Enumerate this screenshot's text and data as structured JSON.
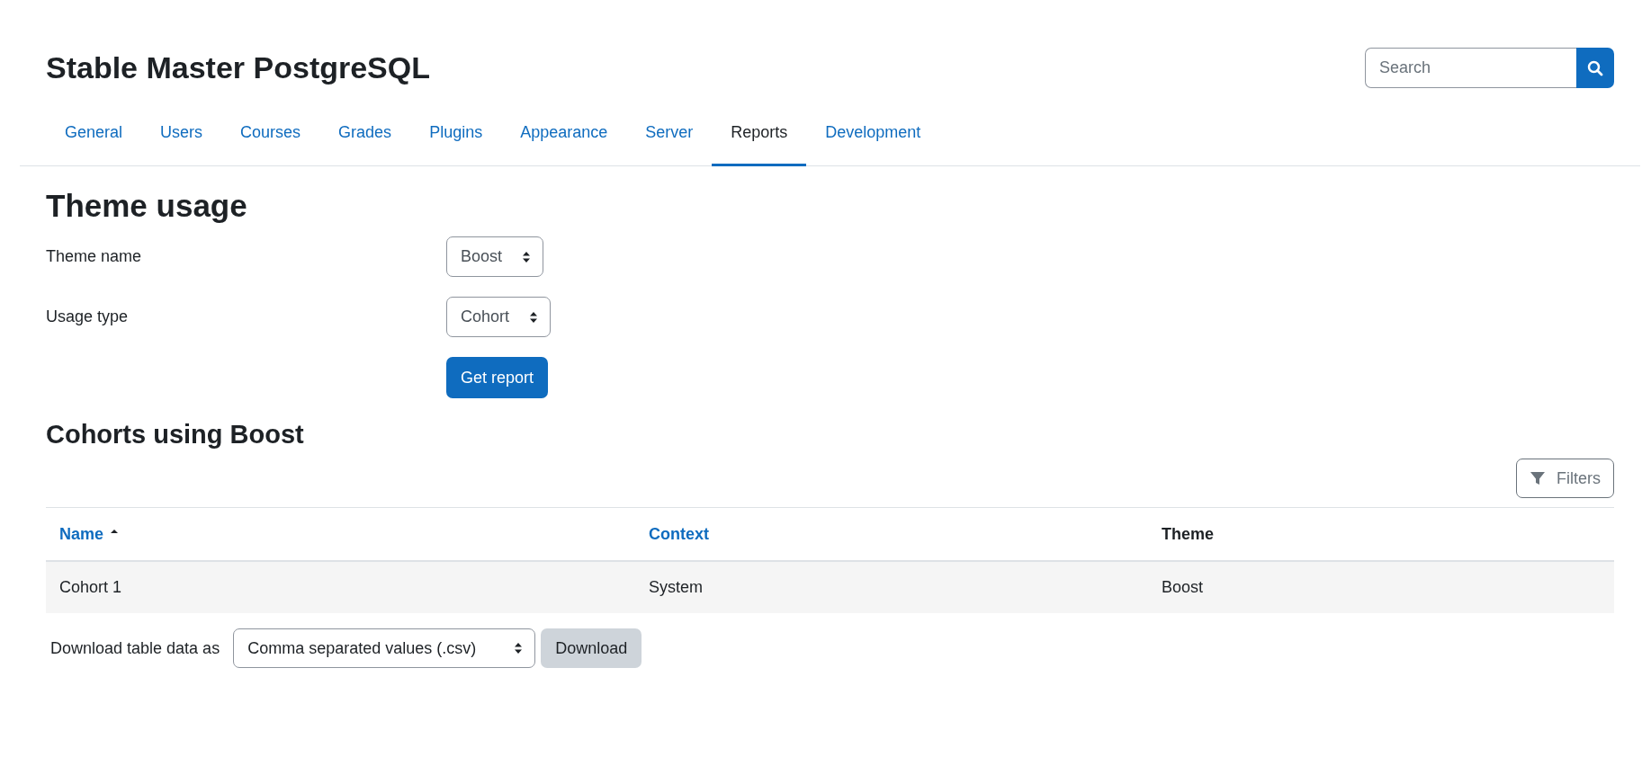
{
  "site_title": "Stable Master PostgreSQL",
  "search": {
    "placeholder": "Search"
  },
  "tabs": [
    {
      "label": "General",
      "selected": false
    },
    {
      "label": "Users",
      "selected": false
    },
    {
      "label": "Courses",
      "selected": false
    },
    {
      "label": "Grades",
      "selected": false
    },
    {
      "label": "Plugins",
      "selected": false
    },
    {
      "label": "Appearance",
      "selected": false
    },
    {
      "label": "Server",
      "selected": false
    },
    {
      "label": "Reports",
      "selected": true
    },
    {
      "label": "Development",
      "selected": false
    }
  ],
  "page_heading": "Theme usage",
  "form": {
    "fields": [
      {
        "label": "Theme name",
        "value": "Boost"
      },
      {
        "label": "Usage type",
        "value": "Cohort"
      }
    ],
    "submit": "Get report"
  },
  "results_heading": "Cohorts using Boost",
  "filters_button": "Filters",
  "table": {
    "columns": [
      {
        "label": "Name",
        "sortable": true,
        "sorted": true
      },
      {
        "label": "Context",
        "sortable": true,
        "sorted": false
      },
      {
        "label": "Theme",
        "sortable": false,
        "sorted": false
      }
    ],
    "rows": [
      [
        "Cohort 1",
        "System",
        "Boost"
      ]
    ]
  },
  "download": {
    "label": "Download table data as",
    "format": "Comma separated values (.csv)",
    "button": "Download"
  }
}
